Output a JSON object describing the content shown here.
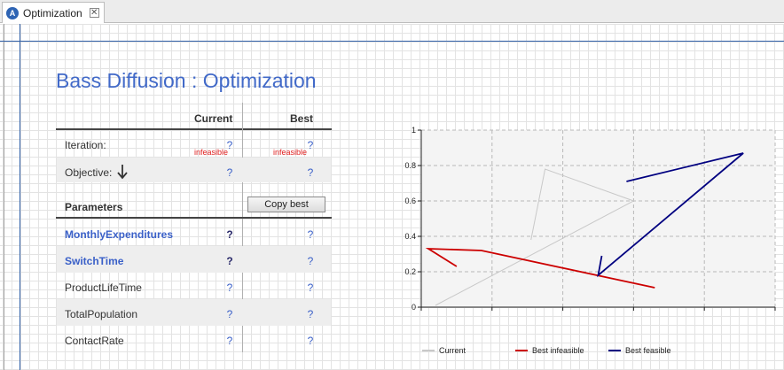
{
  "tab": {
    "label": "Optimization",
    "app_icon": "anylogic-icon"
  },
  "page_title": "Bass Diffusion : Optimization",
  "table": {
    "col_current": "Current",
    "col_best": "Best",
    "iteration": {
      "label": "Iteration:",
      "current": "?",
      "best": "?",
      "current_status": "infeasible",
      "best_status": "infeasible"
    },
    "objective": {
      "label": "Objective:",
      "current": "?",
      "best": "?",
      "direction_icon": "arrow-down-icon"
    },
    "parameters_header": "Parameters",
    "copy_best_label": "Copy best",
    "parameters": [
      {
        "name": "MonthlyExpenditures",
        "current": "?",
        "best": "?",
        "optimized": true
      },
      {
        "name": "SwitchTime",
        "current": "?",
        "best": "?",
        "optimized": true
      },
      {
        "name": "ProductLifeTime",
        "current": "?",
        "best": "?",
        "optimized": false
      },
      {
        "name": "TotalPopulation",
        "current": "?",
        "best": "?",
        "optimized": false
      },
      {
        "name": "ContactRate",
        "current": "?",
        "best": "?",
        "optimized": false
      }
    ]
  },
  "chart_data": {
    "type": "line",
    "xlim": [
      0,
      1
    ],
    "ylim": [
      0,
      1
    ],
    "x_ticks": [
      "0",
      "0.2",
      "0.4",
      "0.6",
      "0.8",
      "1"
    ],
    "y_ticks": [
      "0",
      "0.2",
      "0.4",
      "0.6",
      "0.8",
      "1"
    ],
    "grid": true,
    "legend": "bottom",
    "series": [
      {
        "name": "Current",
        "color": "#c8c8c8",
        "points": [
          [
            0.04,
            0.01
          ],
          [
            0.6,
            0.6
          ],
          [
            0.35,
            0.78
          ],
          [
            0.31,
            0.38
          ]
        ]
      },
      {
        "name": "Best infeasible",
        "color": "#cc0000",
        "points": [
          [
            0.1,
            0.23
          ],
          [
            0.02,
            0.33
          ],
          [
            0.17,
            0.32
          ],
          [
            0.66,
            0.11
          ]
        ]
      },
      {
        "name": "Best feasible",
        "color": "#000080",
        "points": [
          [
            0.58,
            0.71
          ],
          [
            0.91,
            0.87
          ],
          [
            0.5,
            0.18
          ],
          [
            0.51,
            0.29
          ]
        ]
      }
    ]
  }
}
